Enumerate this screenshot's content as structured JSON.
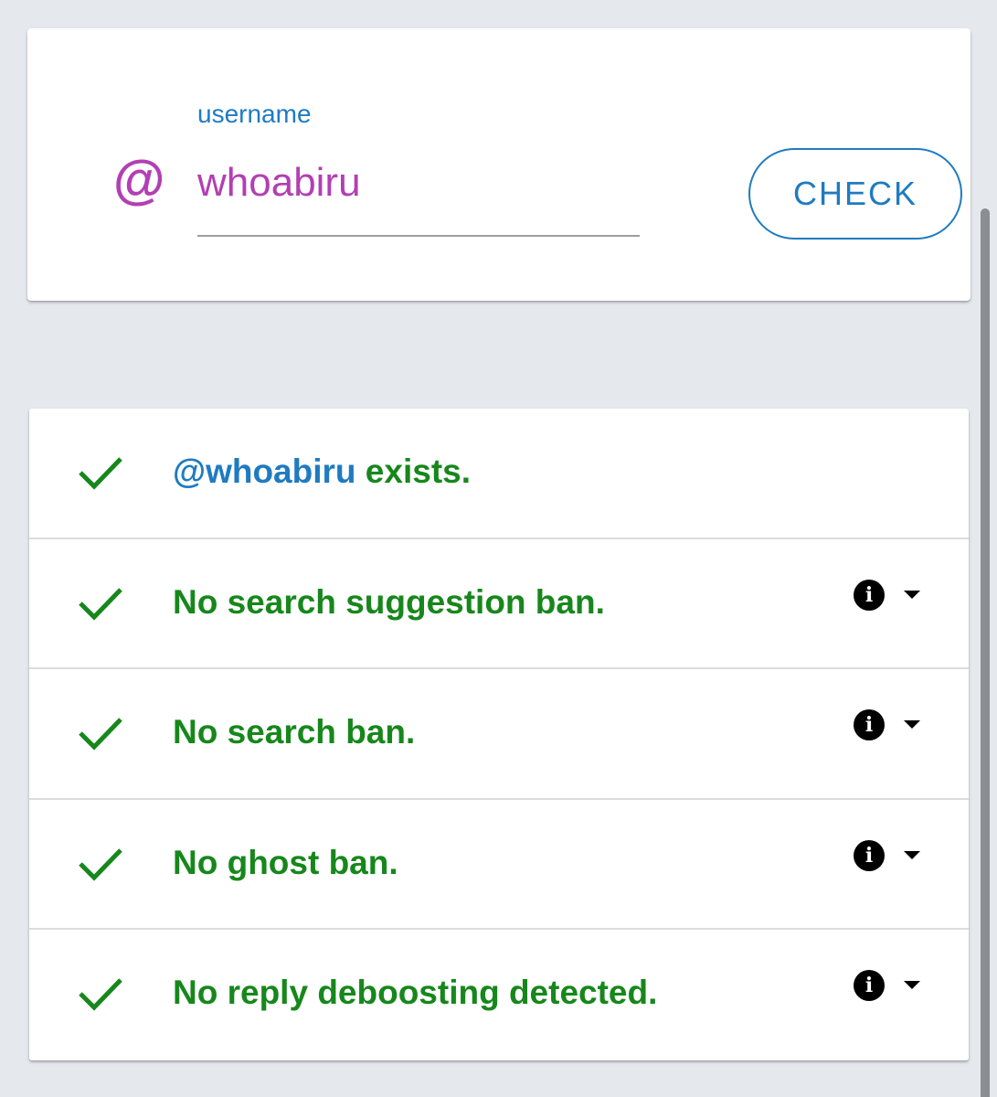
{
  "search": {
    "at_symbol": "@",
    "label": "username",
    "value": "whoabiru",
    "button_label": "CHECK"
  },
  "results": [
    {
      "username": "@whoabiru",
      "text": " exists.",
      "status": "pass",
      "has_details": false
    },
    {
      "text": "No search suggestion ban.",
      "status": "pass",
      "has_details": true
    },
    {
      "text": "No search ban.",
      "status": "pass",
      "has_details": true
    },
    {
      "text": "No ghost ban.",
      "status": "pass",
      "has_details": true
    },
    {
      "text": "No reply deboosting detected.",
      "status": "pass",
      "has_details": true
    }
  ],
  "icons": {
    "check": "check-icon",
    "info": "info-icon",
    "expand": "chevron-down-icon"
  },
  "colors": {
    "accent_blue": "#1f7bc0",
    "accent_purple": "#b23fb3",
    "success_green": "#17871c",
    "background": "#e5e9ee"
  }
}
